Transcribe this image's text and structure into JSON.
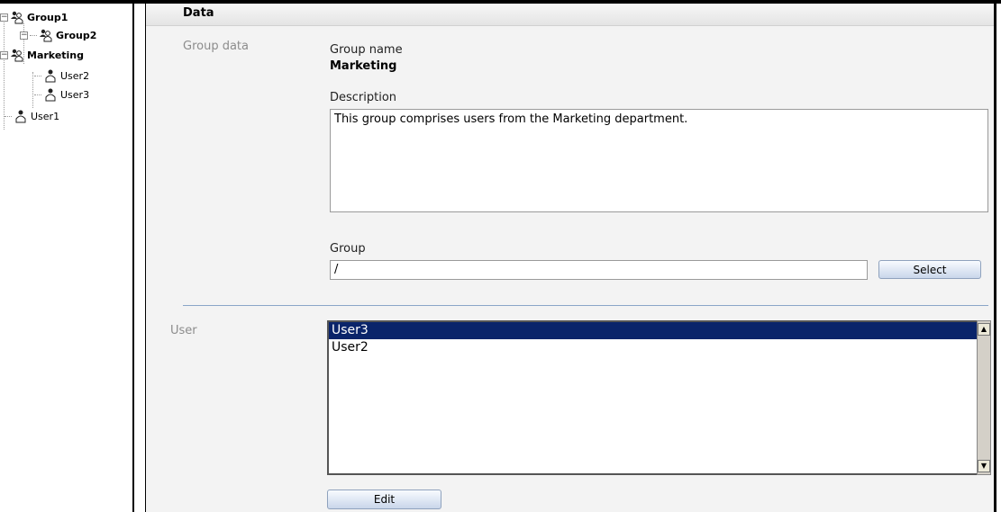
{
  "tree": {
    "nodes": [
      {
        "label": "Group1",
        "type": "group",
        "bold": true,
        "toggle": "−"
      },
      {
        "label": "Group2",
        "type": "group",
        "bold": true,
        "toggle": "−"
      },
      {
        "label": "Marketing",
        "type": "group",
        "bold": true,
        "toggle": "−"
      },
      {
        "label": "User2",
        "type": "user",
        "bold": false
      },
      {
        "label": "User3",
        "type": "user",
        "bold": false
      },
      {
        "label": "User1",
        "type": "user",
        "bold": false
      }
    ]
  },
  "main": {
    "header_title": "Data",
    "group_data_section": "Group data",
    "group_name_label": "Group name",
    "group_name_value": "Marketing",
    "description_label": "Description",
    "description_value": "This group comprises users from the Marketing department.",
    "group_label": "Group",
    "group_value": "/",
    "select_button": "Select",
    "user_section": "User",
    "users": [
      "User3",
      "User2"
    ],
    "selected_user": "User3",
    "edit_button": "Edit"
  },
  "colors": {
    "selection": "#0a246a",
    "button_border": "#8fa2bd",
    "separator": "#8aa6c8"
  },
  "icons": {
    "group": "group-icon",
    "user": "user-icon",
    "collapse": "minus-box-icon",
    "scroll_up": "scroll-up-arrow-icon",
    "scroll_down": "scroll-down-arrow-icon"
  }
}
